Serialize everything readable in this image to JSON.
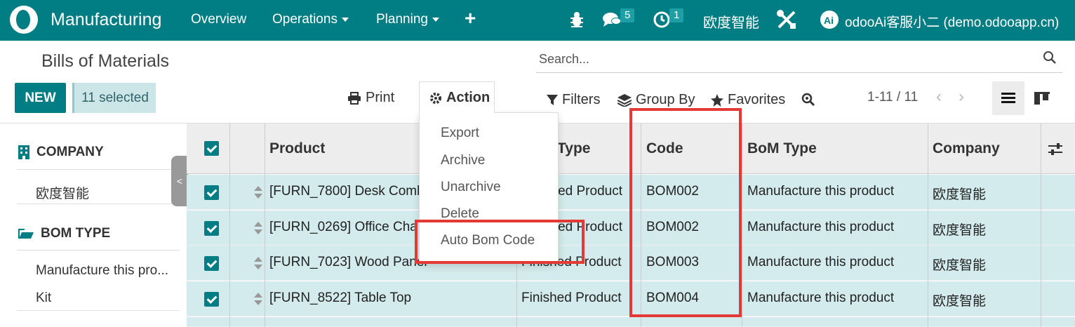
{
  "navbar": {
    "app_title": "Manufacturing",
    "menu": [
      {
        "label": "Overview"
      },
      {
        "label": "Operations"
      },
      {
        "label": "Planning"
      }
    ],
    "add_icon": "+",
    "messages_count": "5",
    "activities_count": "1",
    "company": "欧度智能",
    "user": "odooAi客服小二 (demo.odooapp.cn)",
    "brand_color": "#017e84"
  },
  "control_panel": {
    "title": "Bills of Materials",
    "search_placeholder": "Search...",
    "new_label": "NEW",
    "selected_label": "11 selected",
    "print_label": "Print",
    "action_label": "Action",
    "filters_label": "Filters",
    "groupby_label": "Group By",
    "favorites_label": "Favorites",
    "pager": "1-11 / 11"
  },
  "action_menu": {
    "items": [
      "Export",
      "Archive",
      "Unarchive",
      "Delete",
      "Auto Bom Code"
    ]
  },
  "sidebar": {
    "company_heading": "COMPANY",
    "company_items": [
      "欧度智能"
    ],
    "bomtype_heading": "BOM TYPE",
    "bomtype_items": [
      "Manufacture this pro...",
      "Kit"
    ]
  },
  "table": {
    "columns": [
      "Product",
      "Type",
      "Code",
      "BoM Type",
      "Company"
    ],
    "rows": [
      {
        "product": "[FURN_7800] Desk Comb",
        "type": "ished Product",
        "code": "BOM002",
        "bom_type": "Manufacture this product",
        "company": "欧度智能"
      },
      {
        "product": "[FURN_0269] Office Cha",
        "type": "ished Product",
        "code": "BOM002",
        "bom_type": "Manufacture this product",
        "company": "欧度智能"
      },
      {
        "product": "[FURN_7023] Wood Panel",
        "type": "Finished Product",
        "code": "BOM003",
        "bom_type": "Manufacture this product",
        "company": "欧度智能"
      },
      {
        "product": "[FURN_8522] Table Top",
        "type": "Finished Product",
        "code": "BOM004",
        "bom_type": "Manufacture this product",
        "company": "欧度智能"
      }
    ]
  },
  "highlight_color": "#e53935"
}
